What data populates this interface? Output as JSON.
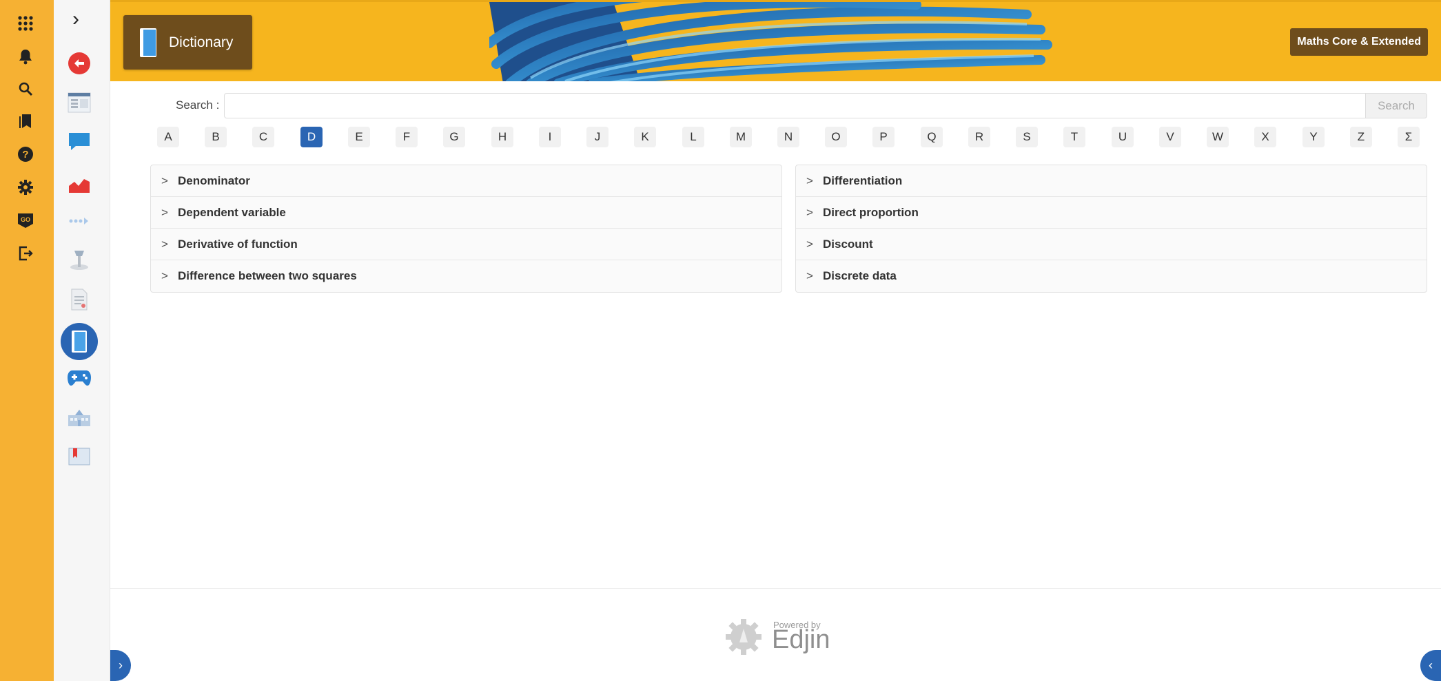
{
  "header": {
    "title": "Dictionary",
    "course_button": "Maths Core & Extended",
    "accent": "#f6b51e",
    "badge_color": "#6e4d1c"
  },
  "rail": {
    "icons": [
      "apps-grid-icon",
      "notification-bell-icon",
      "search-icon",
      "bookmarks-icon",
      "help-icon",
      "settings-gear-icon",
      "go-badge-icon",
      "logout-icon"
    ]
  },
  "sidebar": {
    "expand_glyph": "›",
    "icons": [
      "back-arrow-icon",
      "browser-window-icon",
      "chat-bubble-icon",
      "area-chart-icon",
      "progress-dots-icon",
      "lamp-icon",
      "document-icon",
      "dictionary-book-icon",
      "gamepad-icon",
      "school-building-icon",
      "bookmark-book-icon"
    ],
    "active": "dictionary-book-icon"
  },
  "search": {
    "label": "Search :",
    "placeholder": "",
    "button": "Search"
  },
  "letters": [
    "A",
    "B",
    "C",
    "D",
    "E",
    "F",
    "G",
    "H",
    "I",
    "J",
    "K",
    "L",
    "M",
    "N",
    "O",
    "P",
    "Q",
    "R",
    "S",
    "T",
    "U",
    "V",
    "W",
    "X",
    "Y",
    "Z",
    "Σ"
  ],
  "active_letter": "D",
  "terms_left": [
    "Denominator",
    "Dependent variable",
    "Derivative of function",
    "Difference between two squares"
  ],
  "terms_right": [
    "Differentiation",
    "Direct proportion",
    "Discount",
    "Discrete data"
  ],
  "footer": {
    "powered_by": "Powered by",
    "brand": "Edjin"
  },
  "colors": {
    "rail": "#f6b133",
    "active_blue": "#2a65b3"
  }
}
